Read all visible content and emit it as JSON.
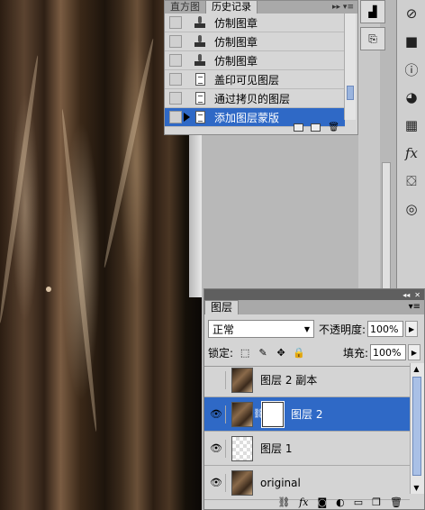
{
  "history_panel": {
    "tabs": [
      "直方图",
      "历史记录"
    ],
    "active_tab": "历史记录",
    "items": [
      {
        "label": "仿制图章",
        "icon": "clone-stamp-icon",
        "selected": false
      },
      {
        "label": "仿制图章",
        "icon": "clone-stamp-icon",
        "selected": false
      },
      {
        "label": "仿制图章",
        "icon": "clone-stamp-icon",
        "selected": false
      },
      {
        "label": "盖印可见图层",
        "icon": "history-state-icon",
        "selected": false
      },
      {
        "label": "通过拷贝的图层",
        "icon": "history-state-icon",
        "selected": false
      },
      {
        "label": "添加图层蒙版",
        "icon": "history-state-icon",
        "selected": true
      }
    ],
    "footer_icons": [
      "new-document-from-state-icon",
      "new-snapshot-icon",
      "delete-state-icon"
    ]
  },
  "right_toolbar": {
    "icons": [
      "navigator-icon",
      "info-icon",
      "color-icon",
      "swatches-icon",
      "styles-icon",
      "actions-icon",
      "paths-icon"
    ]
  },
  "layers_panel": {
    "tab": "图层",
    "blend_mode": "正常",
    "opacity_label": "不透明度:",
    "opacity_value": "100%",
    "lock_label": "锁定:",
    "fill_label": "填充:",
    "fill_value": "100%",
    "layers": [
      {
        "name": "图层 2 副本",
        "visible": false,
        "selected": false,
        "thumb": "photo",
        "has_mask": false
      },
      {
        "name": "图层 2",
        "visible": true,
        "selected": true,
        "thumb": "photo",
        "has_mask": true
      },
      {
        "name": "图层 1",
        "visible": true,
        "selected": false,
        "thumb": "transparent",
        "has_mask": false
      },
      {
        "name": "original",
        "visible": true,
        "selected": false,
        "thumb": "photo",
        "has_mask": false
      }
    ],
    "footer_icons": [
      "link-layers-icon",
      "fx-icon",
      "add-mask-icon",
      "adjustment-layer-icon",
      "group-icon",
      "new-layer-icon",
      "delete-layer-icon"
    ]
  }
}
